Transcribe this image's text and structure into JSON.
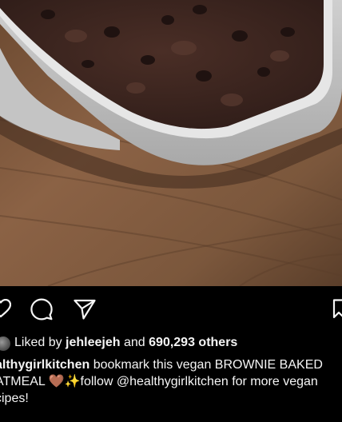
{
  "post": {
    "liked_by_prefix": "Liked by",
    "liked_by_user": "jehleejeh",
    "liked_and": "and",
    "liked_count": "690,293 others",
    "caption_username": "althygirlkitchen",
    "caption_line1": "bookmark this vegan BROWNIE BAKED",
    "caption_line2": "ATMEAL 🤎✨follow @healthygirlkitchen for more vegan",
    "caption_line3": "cipes!"
  },
  "icons": {
    "like": "heart-icon",
    "comment": "comment-icon",
    "share": "send-icon",
    "save": "bookmark-icon"
  },
  "colors": {
    "background": "#000000",
    "text": "#f5f5f5"
  }
}
